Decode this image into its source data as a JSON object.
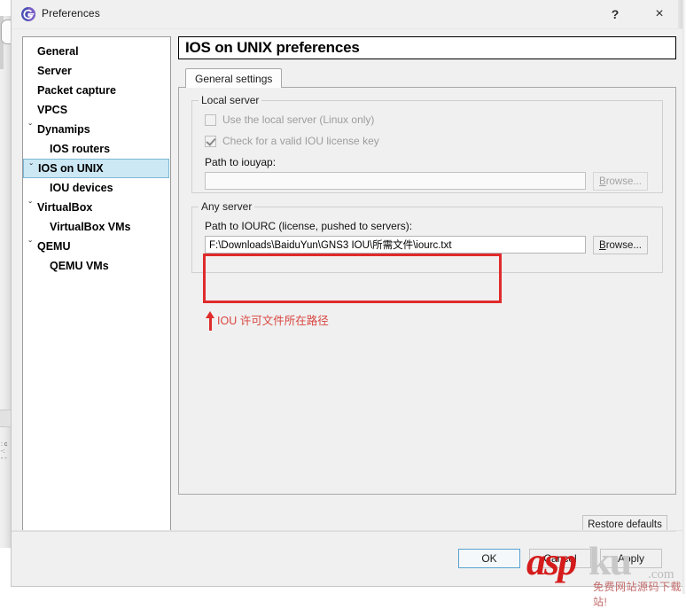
{
  "window": {
    "title": "Preferences",
    "icon": "gns3-app-icon",
    "help_label": "?",
    "close_label": "×"
  },
  "sidebar": {
    "items": [
      {
        "label": "General",
        "level": 0,
        "expander": false,
        "selected": false
      },
      {
        "label": "Server",
        "level": 0,
        "expander": false,
        "selected": false
      },
      {
        "label": "Packet capture",
        "level": 0,
        "expander": false,
        "selected": false
      },
      {
        "label": "VPCS",
        "level": 0,
        "expander": false,
        "selected": false
      },
      {
        "label": "Dynamips",
        "level": 0,
        "expander": true,
        "selected": false
      },
      {
        "label": "IOS routers",
        "level": 1,
        "expander": false,
        "selected": false
      },
      {
        "label": "IOS on UNIX",
        "level": 0,
        "expander": true,
        "selected": true
      },
      {
        "label": "IOU devices",
        "level": 1,
        "expander": false,
        "selected": false
      },
      {
        "label": "VirtualBox",
        "level": 0,
        "expander": true,
        "selected": false
      },
      {
        "label": "VirtualBox VMs",
        "level": 1,
        "expander": false,
        "selected": false
      },
      {
        "label": "QEMU",
        "level": 0,
        "expander": true,
        "selected": false
      },
      {
        "label": "QEMU VMs",
        "level": 1,
        "expander": false,
        "selected": false
      }
    ],
    "expander_glyph": "ˇ"
  },
  "panel": {
    "title": "IOS on UNIX preferences",
    "tab": {
      "label": "General settings",
      "active": true
    }
  },
  "local_server": {
    "group_title": "Local server",
    "use_local_server": {
      "label": "Use the local server (Linux only)",
      "checked": false,
      "enabled": false
    },
    "check_license": {
      "label": "Check for a valid IOU license key",
      "checked": true,
      "enabled": false
    },
    "path_label": "Path to iouyap:",
    "path_value": "",
    "path_placeholder": "",
    "browse_label": "Browse...",
    "browse_accel": "B"
  },
  "any_server": {
    "group_title": "Any server",
    "path_label": "Path to IOURC (license, pushed to servers):",
    "path_value": "F:\\Downloads\\BaiduYun\\GNS3 IOU\\所需文件\\iourc.txt",
    "browse_label": "Browse...",
    "browse_accel": "B"
  },
  "annotation": {
    "caption": "IOU 许可文件所在路径",
    "box_color": "#e02b2b",
    "text_color": "#d9453f",
    "arrow": "up-arrow-icon"
  },
  "buttons": {
    "restore_defaults": "Restore defaults",
    "ok": "OK",
    "cancel": "Cancel",
    "apply": "Apply"
  },
  "watermark": {
    "asp": "asp",
    "ku": "ku",
    "com": ".com",
    "tagline": "免费网站源码下载站!",
    "asp_color": "#d51b1b",
    "ku_color": "#c8c8c8"
  }
}
